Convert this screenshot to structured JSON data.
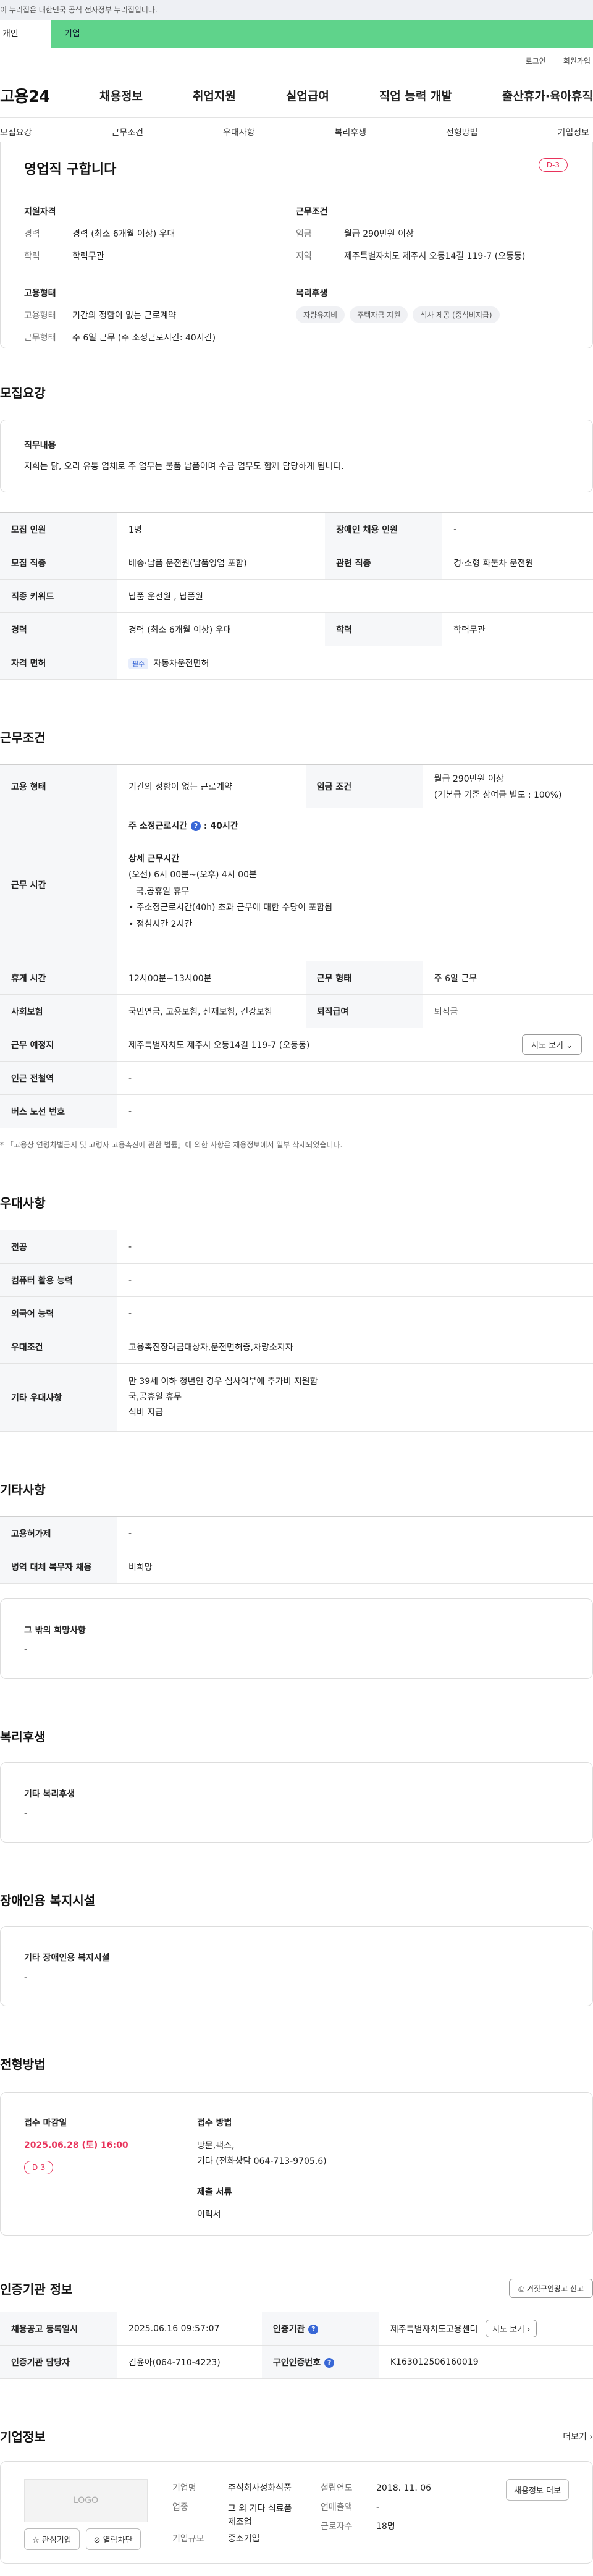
{
  "gov_banner": "이 누리집은 대한민국 공식 전자정부 누리집입니다.",
  "top_tabs": {
    "personal": "개인",
    "company": "기업"
  },
  "util": {
    "login": "로그인",
    "signup": "회원가입"
  },
  "gnb": {
    "logo": "고용24",
    "menu": [
      "채용정보",
      "취업지원",
      "실업급여",
      "직업 능력 개발",
      "출산휴가·육아휴직"
    ]
  },
  "anchor_tabs": [
    "모집요강",
    "근무조건",
    "우대사항",
    "복리후생",
    "전형방법",
    "기업정보"
  ],
  "summary": {
    "title": "영업직 구합니다",
    "dday": "D-3",
    "qual_title": "지원자격",
    "career_k": "경력",
    "career_v": "경력 (최소 6개월 이상) 우대",
    "edu_k": "학력",
    "edu_v": "학력무관",
    "emp_title": "고용형태",
    "emptype_k": "고용형태",
    "emptype_v": "기간의 정함이 없는 근로계약",
    "worktype_k": "근무형태",
    "worktype_v": "주 6일 근무 (주 소정근로시간: 40시간)",
    "cond_title": "근무조건",
    "wage_k": "임금",
    "wage_v": "월급 290만원 이상",
    "region_k": "지역",
    "region_v": "제주특별자치도 제주시 오등14길 119-7 (오등동)",
    "welfare_title": "복리후생",
    "chips": [
      "자량유지비",
      "주택자금 지원",
      "식사 제공 (중식비지급)"
    ]
  },
  "recruit": {
    "title": "모집요강",
    "duty_label": "직무내용",
    "duty_text": "저희는 닭, 오리 유통 업체로 주 업무는 물품 납품이며 수금 업무도 함께 담당하게 됩니다.",
    "rows": [
      {
        "k1": "모집 인원",
        "v1": "1명",
        "k2": "장애인 채용 인원",
        "v2": "-"
      },
      {
        "k1": "모집 직종",
        "v1": "배송·납품 운전원(납품영업 포함)",
        "k2": "관련 직종",
        "v2": "경·소형 화물차 운전원"
      },
      {
        "k1": "직종 키워드",
        "v1": "납품 운전원 , 납품원"
      },
      {
        "k1": "경력",
        "v1": "경력 (최소 6개월 이상) 우대",
        "k2": "학력",
        "v2": "학력무관"
      }
    ],
    "license_k": "자격 면허",
    "license_badge": "필수",
    "license_v": "자동차운전면허"
  },
  "work": {
    "title": "근무조건",
    "emp_k": "고용 형태",
    "emp_v": "기간의 정함이 없는 근로계약",
    "wage_k": "임금 조건",
    "wage_v1": "월급 290만원 이상",
    "wage_v2": "(기본급 기준 상여금 별도 : 100%)",
    "hours_k": "근무 시간",
    "hours_head": "주 소정근로시간",
    "hours_head_v": ": 40시간",
    "hours_detail_title": "상세 근무시간",
    "hours_lines": [
      "(오전) 6시 00분~(오후) 4시 00분",
      "   국,공휴일 휴무",
      "• 주소정근로시간(40h) 초과 근무에 대한 수당이 포함됨",
      "• 점심시간  2시간"
    ],
    "rest_k": "휴게 시간",
    "rest_v": "12시00분~13시00분",
    "wtype_k": "근무 형태",
    "wtype_v": "주 6일 근무",
    "ins_k": "사회보험",
    "ins_v": "국민연금, 고용보험, 산재보험, 건강보험",
    "ret_k": "퇴직급여",
    "ret_v": "퇴직금",
    "loc_k": "근무 예정지",
    "loc_v": "제주특별자치도 제주시 오등14길 119-7 (오등동)",
    "map_btn": "지도 보기",
    "station_k": "인근 전철역",
    "station_v": "-",
    "bus_k": "버스 노선 번호",
    "bus_v": "-",
    "note": "* 「고용상 연령차별금지 및 고령자 고용촉진에 관한 법률」에 의한 사항은 채용정보에서 일부 삭제되었습니다."
  },
  "pref": {
    "title": "우대사항",
    "rows": [
      {
        "k": "전공",
        "v": "-"
      },
      {
        "k": "컴퓨터 활용 능력",
        "v": "-"
      },
      {
        "k": "외국어 능력",
        "v": "-"
      },
      {
        "k": "우대조건",
        "v": "고용촉진장려금대상자,운전면허증,차량소지자"
      }
    ],
    "etc_k": "기타 우대사항",
    "etc_lines": [
      "만 39세 이하 청년인 경우 심사여부에 추가비 지원함",
      "국,공휴일 휴무",
      "식비 지급"
    ]
  },
  "other": {
    "title": "기타사항",
    "rows": [
      {
        "k": "고용허가제",
        "v": "-"
      },
      {
        "k": "병역 대체 복무자 채용",
        "v": "비희망"
      }
    ],
    "hope_label": "그 밖의 희망사항",
    "hope_v": "-"
  },
  "welfare": {
    "title": "복리후생",
    "label": "기타 복리후생",
    "v": "-"
  },
  "disabled": {
    "title": "장애인용 복지시설",
    "label": "기타 장애인용 복지시설",
    "v": "-"
  },
  "selection": {
    "title": "전형방법",
    "deadline_label": "접수 마감일",
    "deadline": "2025.06.28 (토) 16:00",
    "dday": "D-3",
    "method_label": "접수 방법",
    "method_l1": "방문,팩스,",
    "method_l2": "기타 (전화상담 064-713-9705.6)",
    "docs_label": "제출 서류",
    "docs_v": "이력서"
  },
  "agency": {
    "title": "인증기관 정보",
    "report_btn": "거짓구인광고 신고",
    "reg_k": "채용공고 등록일시",
    "reg_v": "2025.06.16 09:57:07",
    "org_k": "인증기관",
    "org_v": "제주특별자치도고용센터",
    "map_btn": "지도 보기",
    "mgr_k": "인증기관 담당자",
    "mgr_v": "김윤아(064-710-4223)",
    "id_k": "구인인증번호",
    "id_v": "K163012506160019"
  },
  "company": {
    "title": "기업정보",
    "more": "더보기",
    "logo": "LOGO",
    "fav_btn": "관심기업",
    "block_btn": "열람차단",
    "name_k": "기업명",
    "name_v": "주식회사성화식품",
    "biz_k": "업종",
    "biz_v1": "그 외 기타 식료품",
    "biz_v2": "제조업",
    "size_k": "기업규모",
    "size_v": "중소기업",
    "est_k": "설립연도",
    "est_v": "2018. 11. 06",
    "sales_k": "연매출액",
    "sales_v": "-",
    "emp_k": "근로자수",
    "emp_v": "18명",
    "job_btn": "채용정보 더보"
  }
}
